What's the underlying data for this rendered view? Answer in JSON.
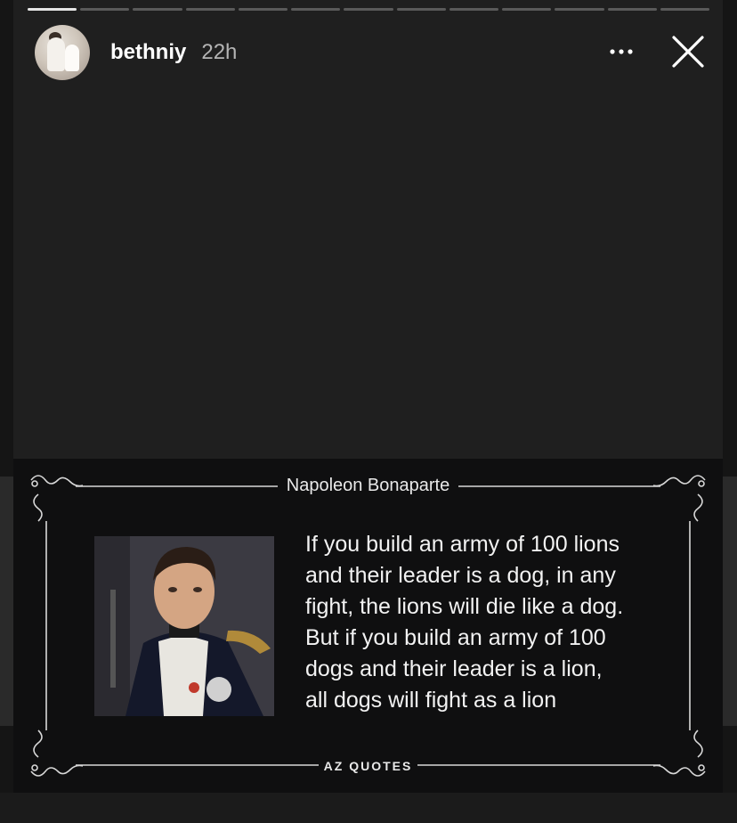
{
  "story": {
    "username": "bethniy",
    "time": "22h",
    "progress_segments": 13,
    "progress_completed": 1,
    "more_icon": "more-horizontal-icon",
    "close_icon": "close-icon"
  },
  "quote_card": {
    "author": "Napoleon Bonaparte",
    "quote_lines": [
      "If you build an army of 100 lions",
      "and their leader is a dog, in any",
      "fight, the lions will die like a dog.",
      "But if you build an army of 100",
      "dogs and their leader is a lion,",
      "all dogs will fight as a lion"
    ],
    "brand": "AZ QUOTES"
  },
  "colors": {
    "background": "#151515",
    "story_bg": "#1f1f1f",
    "card_bg": "#0f0f10",
    "text": "#ffffff"
  }
}
